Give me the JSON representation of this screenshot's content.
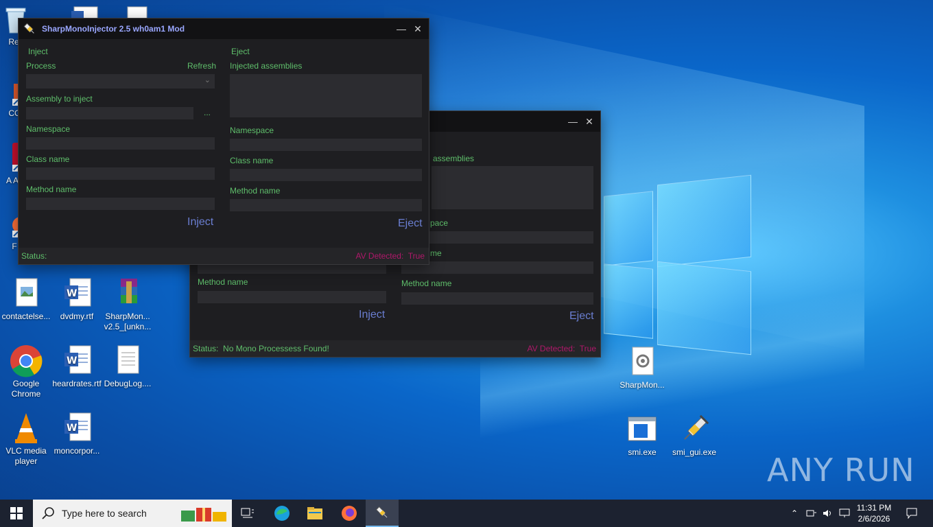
{
  "desktop": {
    "left_icons": [
      {
        "label": "Rec"
      },
      {
        "label": "CC"
      },
      {
        "label": "A Ac"
      },
      {
        "label": "F"
      },
      {
        "label": "contactelse..."
      },
      {
        "label": "dvdmy.rtf"
      },
      {
        "label": "SharpMon... v2.5_[unkn..."
      },
      {
        "label": "Google Chrome"
      },
      {
        "label": "heardrates.rtf"
      },
      {
        "label": "DebugLog...."
      },
      {
        "label": "VLC media player"
      },
      {
        "label": "moncorpor..."
      }
    ],
    "right_icons": [
      {
        "label": "SharpMon..."
      },
      {
        "label": "smi.exe"
      },
      {
        "label": "smi_gui.exe"
      }
    ]
  },
  "front_window": {
    "title": "SharpMonoInjector 2.5 wh0am1 Mod",
    "inject_section": "Inject",
    "eject_section": "Eject",
    "process_label": "Process",
    "refresh_label": "Refresh",
    "assembly_label": "Assembly to inject",
    "browse_label": "...",
    "namespace_label": "Namespace",
    "classname_label": "Class name",
    "methodname_label": "Method name",
    "inject_button": "Inject",
    "injected_assemblies_label": "Injected assemblies",
    "eject_namespace_label": "Namespace",
    "eject_classname_label": "Class name",
    "eject_methodname_label": "Method name",
    "eject_button": "Eject",
    "status_label": "Status:",
    "status_value": "",
    "av_label": "AV Detected:",
    "av_value": "True"
  },
  "back_window": {
    "injected_assemblies_partial": "assemblies",
    "namespace_partial": "pace",
    "classname_partial": "me",
    "methodname_left": "Method name",
    "methodname_right": "Method name",
    "inject_button": "Inject",
    "eject_button": "Eject",
    "status_label": "Status:",
    "status_value": "No Mono Processess Found!",
    "av_label": "AV Detected:",
    "av_value": "True"
  },
  "taskbar": {
    "search_placeholder": "Type here to search",
    "time": "11:31 PM",
    "date": "2/6/2026"
  },
  "watermark": "ANY RUN",
  "colors": {
    "accent_green": "#5fbf6b",
    "button_blue": "#6a7ed1",
    "title_blue": "#9aa7ff",
    "av_red": "#b0186a"
  }
}
